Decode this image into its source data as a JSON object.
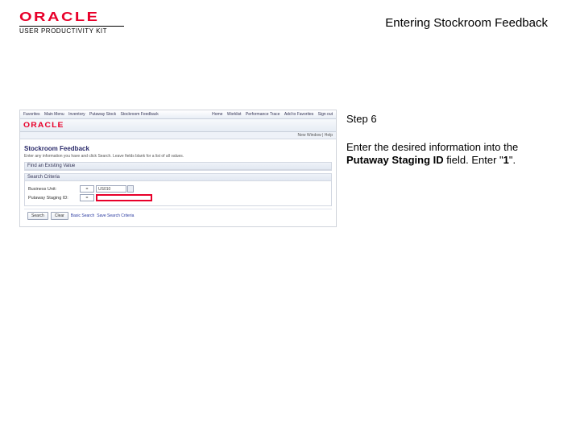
{
  "header": {
    "brand": "ORACLE",
    "subbrand": "USER PRODUCTIVITY KIT",
    "title": "Entering Stockroom Feedback"
  },
  "step": {
    "label": "Step 6",
    "line1": "Enter the desired information into the ",
    "bold": "Putaway Staging ID",
    "line2": " field. Enter \"",
    "value_bold": "1",
    "line3": "\"."
  },
  "app": {
    "crumbs": [
      "Favorites",
      "Main Menu",
      "Inventory",
      "Putaway Stock",
      "Stockroom Feedback"
    ],
    "actions": [
      "Home",
      "Worklist",
      "Performance Trace",
      "Add to Favorites",
      "Sign out"
    ],
    "brand": "ORACLE",
    "tabs": [],
    "subbar": "New Window | Help",
    "page_title": "Stockroom Feedback",
    "hint": "Enter any information you have and click Search. Leave fields blank for a list of all values.",
    "sections": {
      "find": {
        "title": "Find an Existing Value"
      },
      "criteria": {
        "title": "Search Criteria"
      }
    },
    "fields": {
      "business_unit": {
        "label": "Business Unit:",
        "seg1": "=",
        "seg2": "US010"
      },
      "putaway_staging_id": {
        "label": "Putaway Staging ID:",
        "seg1": "=",
        "value": ""
      }
    },
    "buttons": {
      "search": "Search",
      "clear": "Clear",
      "basic": "Basic Search",
      "save": "Save Search Criteria"
    }
  }
}
